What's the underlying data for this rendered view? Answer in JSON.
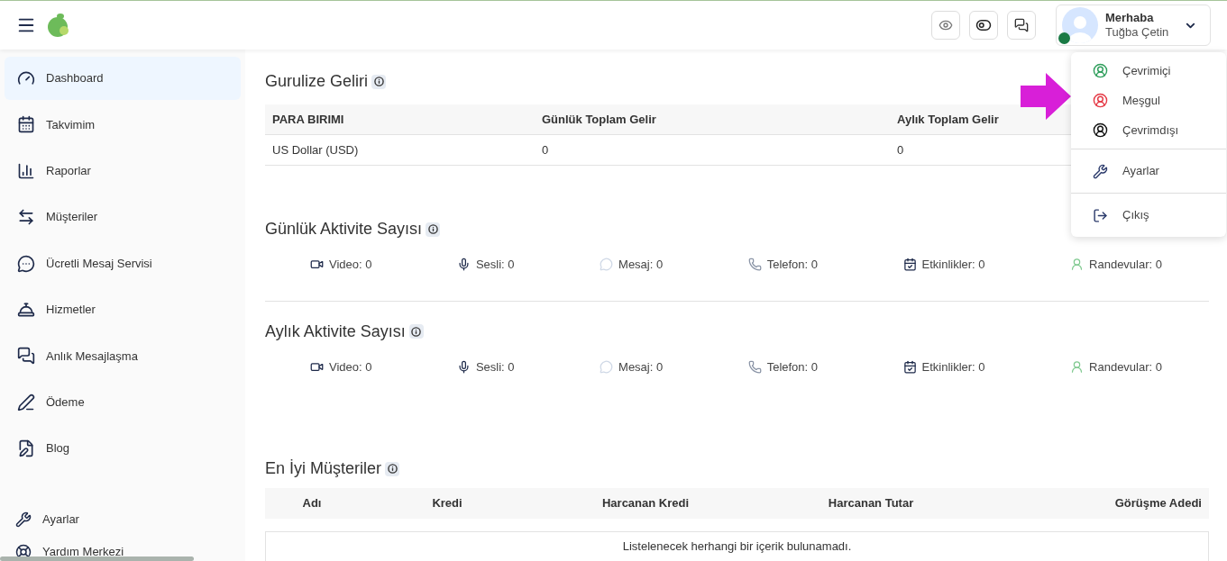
{
  "user": {
    "greeting": "Merhaba",
    "name": "Tuğba Çetin"
  },
  "sidebar": {
    "items": [
      {
        "label": "Dashboard",
        "selected": true
      },
      {
        "label": "Takvimim",
        "selected": false
      },
      {
        "label": "Raporlar",
        "selected": false
      },
      {
        "label": "Müşteriler",
        "selected": false
      },
      {
        "label": "Ücretli Mesaj Servisi",
        "selected": false
      },
      {
        "label": "Hizmetler",
        "selected": false
      },
      {
        "label": "Anlık Mesajlaşma",
        "selected": false
      },
      {
        "label": "Ödeme",
        "selected": false
      },
      {
        "label": "Blog",
        "selected": false
      }
    ],
    "footer_items": [
      {
        "label": "Ayarlar"
      },
      {
        "label": "Yardım Merkezi"
      }
    ]
  },
  "revenue": {
    "title": "Gurulize Geliri",
    "columns": [
      "PARA BIRIMI",
      "Günlük Toplam Gelir",
      "Aylık Toplam Gelir"
    ],
    "rows": [
      [
        "US Dollar (USD)",
        "0",
        "0"
      ]
    ]
  },
  "daily_activity": {
    "title": "Günlük Aktivite Sayısı",
    "items": [
      "Video: 0",
      "Sesli: 0",
      "Mesaj: 0",
      "Telefon: 0",
      "Etkinlikler: 0",
      "Randevular: 0"
    ]
  },
  "monthly_activity": {
    "title": "Aylık Aktivite Sayısı",
    "items": [
      "Video: 0",
      "Sesli: 0",
      "Mesaj: 0",
      "Telefon: 0",
      "Etkinlikler: 0",
      "Randevular: 0"
    ]
  },
  "top_customers": {
    "title": "En İyi Müşteriler",
    "columns": [
      "Adı",
      "Kredi",
      "Harcanan Kredi",
      "Harcanan Tutar",
      "Görüşme Adedi"
    ],
    "empty_message": "Listelenecek herhangi bir içerik bulunamadı."
  },
  "user_menu": {
    "statuses": [
      {
        "label": "Çevrimiçi",
        "color": "#2e9e5b"
      },
      {
        "label": "Meşgul",
        "color": "#e53945"
      },
      {
        "label": "Çevrimdışı",
        "color": "#111111"
      }
    ],
    "links": [
      {
        "label": "Ayarlar"
      },
      {
        "label": "Çıkış"
      }
    ]
  }
}
